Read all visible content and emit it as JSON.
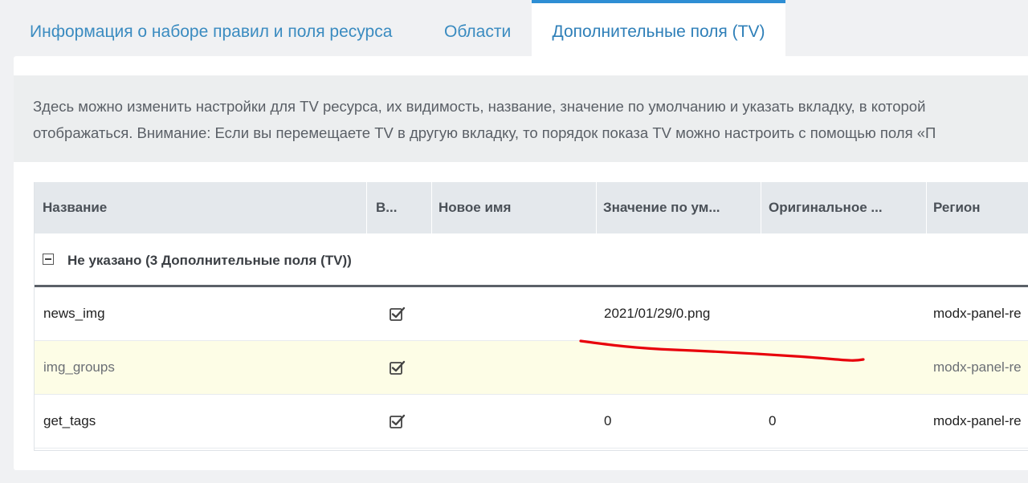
{
  "tabs": [
    {
      "label": "Информация о наборе правил и поля ресурса"
    },
    {
      "label": "Области"
    },
    {
      "label": "Дополнительные поля (TV)"
    }
  ],
  "description": {
    "line1": "Здесь можно изменить настройки для TV ресурса, их видимость, название, значение по умолчанию и указать вкладку, в которой",
    "line2": "отображаться. Внимание: Если вы перемещаете TV в другую вкладку, то порядок показа TV можно настроить с помощью поля «П"
  },
  "grid": {
    "columns": [
      {
        "label": "Название"
      },
      {
        "label": "В..."
      },
      {
        "label": "Новое имя"
      },
      {
        "label": "Значение по ум..."
      },
      {
        "label": "Оригинальное ..."
      },
      {
        "label": "Регион"
      }
    ],
    "group": {
      "label": "Не указано (3 Дополнительные поля (TV))"
    },
    "rows": [
      {
        "name": "news_img",
        "visible": true,
        "new_name": "",
        "default_value": "2021/01/29/0.png",
        "original": "",
        "region": "modx-panel-re"
      },
      {
        "name": "img_groups",
        "visible": true,
        "new_name": "",
        "default_value": "",
        "original": "",
        "region": "modx-panel-re"
      },
      {
        "name": "get_tags",
        "visible": true,
        "new_name": "",
        "default_value": "0",
        "original": "0",
        "region": "modx-panel-re"
      }
    ]
  },
  "colors": {
    "accent": "#2e8ed4",
    "highlight_row": "#fdfde6",
    "annotation": "#e8000b"
  }
}
